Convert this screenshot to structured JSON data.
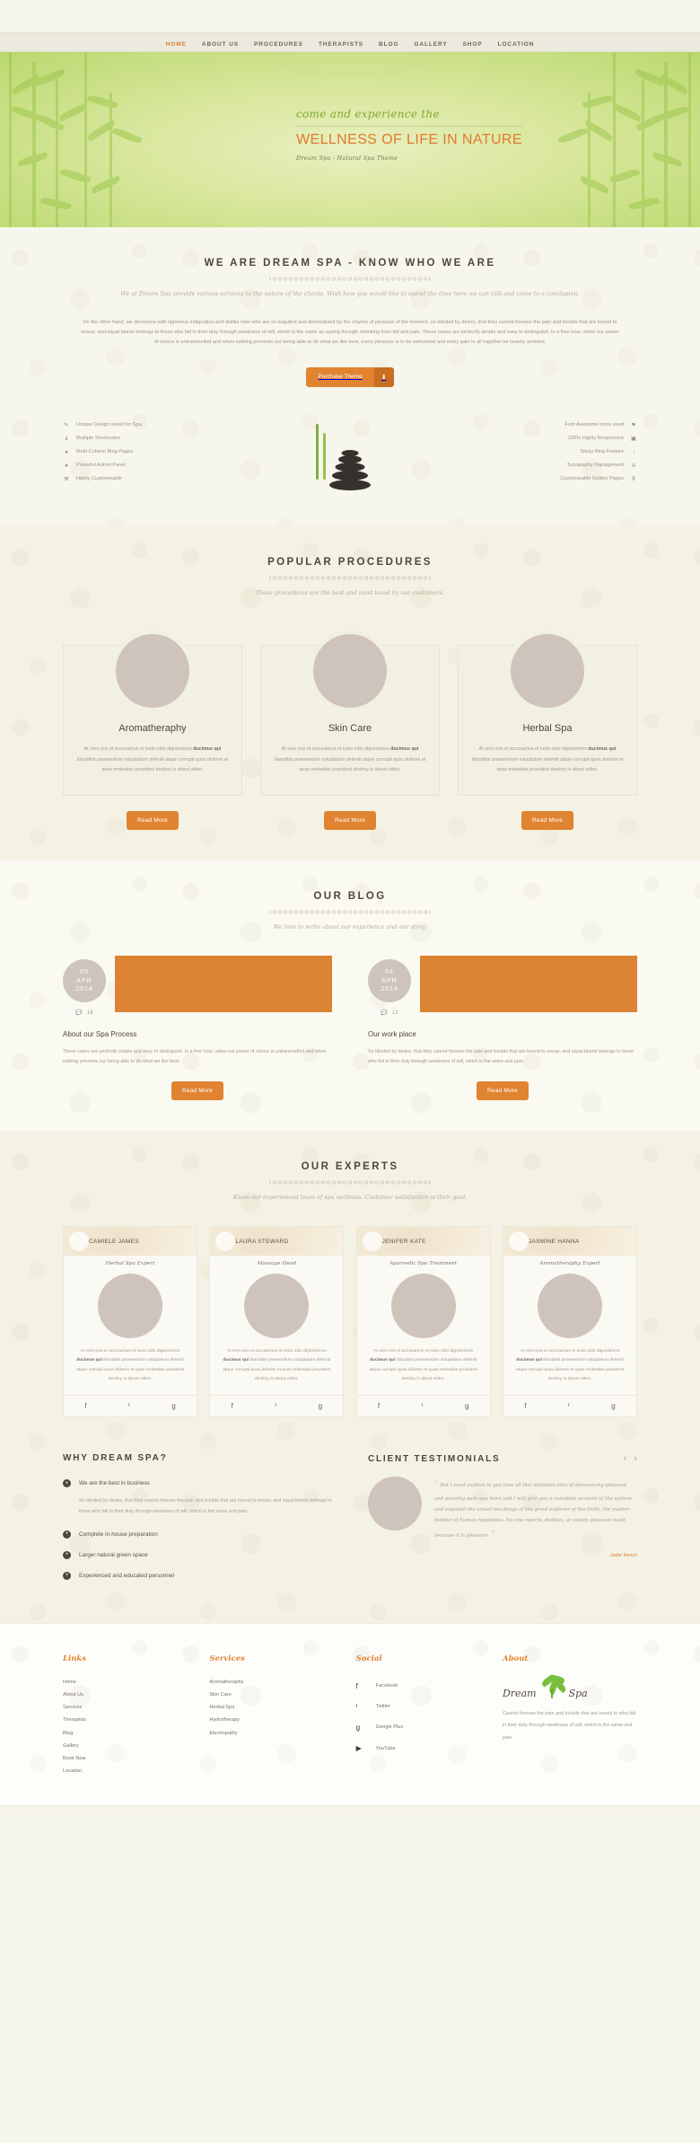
{
  "nav": {
    "items": [
      {
        "label": "HOME",
        "active": true
      },
      {
        "label": "ABOUT US",
        "active": false
      },
      {
        "label": "PROCEDURES",
        "active": false
      },
      {
        "label": "THERAPISTS",
        "active": false
      },
      {
        "label": "BLOG",
        "active": false
      },
      {
        "label": "GALLERY",
        "active": false
      },
      {
        "label": "SHOP",
        "active": false
      },
      {
        "label": "LOCATION",
        "active": false
      }
    ]
  },
  "hero": {
    "pretitle": "come and experience the",
    "title": "WELLNESS OF LIFE IN NATURE",
    "subtitle": "Dream Spa - Natural Spa Theme",
    "accent_green": "#7fa832",
    "accent_orange": "#e07a2c"
  },
  "about": {
    "heading": "WE ARE DREAM SPA - KNOW WHO WE ARE",
    "tagline": "We at Dream Spa provide various services to the nature of the clients. Wish how you would like to spend the time here we can talk and come to a conclusion.",
    "paragraph": "On the other hand, we denounce with righteous indignation and dislike men who are so beguiled and demoralized by the charms of pleasure of the moment, so blinded by desire, that they cannot foresee the pain and trouble that are bound to ensue; and equal blame belongs to those who fail in their duty through weakness of will, which is the same as saying through shrinking from toil and pain. These cases are perfectly simple and easy to distinguish. In a free hour, when our power of choice is untrammelled and when nothing prevents our being able to do what we like best, every pleasure is to be welcomed and every pain in all together be heavily avoided.",
    "purchase_label": "Purchase Theme",
    "purchase_icon": "download-icon",
    "features_left": [
      {
        "icon": "pencil-icon",
        "glyph": "✎",
        "label": "Unique Design suited for Spa"
      },
      {
        "icon": "info-icon",
        "glyph": "ℹ",
        "label": "Multiple Shortcodes"
      },
      {
        "icon": "comment-icon",
        "glyph": "●",
        "label": "Multi-Column Blog Pages"
      },
      {
        "icon": "dot-icon",
        "glyph": "●",
        "label": "Powerful Admin Panel"
      },
      {
        "icon": "wrench-icon",
        "glyph": "⚒",
        "label": "Highly Customisable"
      }
    ],
    "features_right": [
      {
        "icon": "flag-icon",
        "glyph": "⚑",
        "label": "Font Awesome Icons used"
      },
      {
        "icon": "desktop-icon",
        "glyph": "▣",
        "label": "100% Highly Responsive"
      },
      {
        "icon": "pin-icon",
        "glyph": "↓",
        "label": "Sticky Blog Feature"
      },
      {
        "icon": "font-icon",
        "glyph": "A",
        "label": "Typography Management"
      },
      {
        "icon": "filter-icon",
        "glyph": "∇",
        "label": "Customisable Gallery Pages"
      }
    ]
  },
  "procedures": {
    "heading": "POPULAR PROCEDURES",
    "tagline": "These procedures are the best and most loved by our customers.",
    "read_more": "Read More",
    "cards": [
      {
        "title": "Aromatheraphy",
        "body_pre": "At vero eos et accusamus et iusto odio dignissimos ",
        "body_bold": "ducimus qui",
        "body_post": " blanditiis praesentium voluptatum deleniti atque corrupti quos dolores et quas molestias provident destroy is about video."
      },
      {
        "title": "Skin Care",
        "body_pre": "At vero eos et accusamus et iusto odio dignissimos ",
        "body_bold": "ducimus qui",
        "body_post": " blanditiis praesentium voluptatum deleniti atque corrupti quos dolores et quas molestias provident destroy is about video."
      },
      {
        "title": "Herbal Spa",
        "body_pre": "At vero eos et accusamus et iusto odio dignissimos ",
        "body_bold": "ducimus qui",
        "body_post": " blanditiis praesentium voluptatum deleniti atque corrupti quos dolores et quas molestias provident destroy is about video."
      }
    ]
  },
  "blog": {
    "heading": "OUR BLOG",
    "tagline": "We love to write about our experience and our story.",
    "read_more": "Read More",
    "posts": [
      {
        "day": "05",
        "month": "APR",
        "year": "2014",
        "comments": "18",
        "title": "About our Spa Process",
        "body": "These cases are perfectly simple and easy to distinguish. In a free hour, when our power of choice is untrammelled and when nothing prevents our being able to do what we like best.",
        "thumb_color": "#dd8434"
      },
      {
        "day": "04",
        "month": "APR",
        "year": "2014",
        "comments": "12",
        "title": "Our work place",
        "body": "So blinded by desire, that they cannot foresee the pain and trouble that are bound to ensue; and equal blame belongs to those who fail in their duty through weakness of will, which is the same and pain.",
        "thumb_color": "#dd8434"
      }
    ]
  },
  "experts": {
    "heading": "OUR EXPERTS",
    "tagline": "Know our experienced team of spa wellness. Customer satisfaction is their goal.",
    "members": [
      {
        "name": "CAMIELE JAMES",
        "role": "Herbal Spa Expert",
        "body_pre": "At vero eos et accusamus et iusto odio dignissimos ",
        "body_bold": "ducimus qui",
        "body_post": " blanditiis praesentium voluptatum deleniti atque corrupti quos dolores et quas molestias provident destiny is about video.",
        "socials": [
          "facebook-icon",
          "twitter-icon",
          "google-plus-icon"
        ]
      },
      {
        "name": "LAURA STEWARD",
        "role": "Massage Head",
        "body_pre": "At vero eos et accusamus et iusto odio dignissimos ",
        "body_bold": "ducimus qui",
        "body_post": " blanditiis praesentium voluptatum deleniti atque corrupti quos dolores et quas molestias provident destiny is about video.",
        "socials": [
          "facebook-icon",
          "twitter-icon",
          "google-plus-icon"
        ]
      },
      {
        "name": "JENIFER KATE",
        "role": "Ayurvedic Spa Treatment",
        "body_pre": "At vero eos et accusamus et iusto odio dignissimos ",
        "body_bold": "ducimus qui",
        "body_post": " blanditiis praesentium voluptatum deleniti atque corrupti quos dolores et quas molestias provident destiny is about video.",
        "socials": [
          "facebook-icon",
          "twitter-icon",
          "google-plus-icon"
        ]
      },
      {
        "name": "JASMINE HANNA",
        "role": "Aromatheraphy Expert",
        "body_pre": "At vero eos et accusamus et iusto odio dignissimos ",
        "body_bold": "ducimus qui",
        "body_post": " blanditiis praesentium voluptatum deleniti atque corrupti quos dolores et quas molestias provident destiny is about video.",
        "socials": [
          "facebook-icon",
          "twitter-icon",
          "google-plus-icon"
        ]
      }
    ]
  },
  "why": {
    "heading": "WHY DREAM SPA?",
    "items": [
      {
        "title": "We are the best in business",
        "body": "So blinded by desire, that they cannot foresee the pain and trouble that are bound to ensue; and equal blame belongs to those who fail in their duty through weakness of will, which is the same and pain.",
        "open": true
      },
      {
        "title": "Complete in-house preparation",
        "body": "",
        "open": false
      },
      {
        "title": "Larger natural green space",
        "body": "",
        "open": false
      },
      {
        "title": "Experienced and educated personnel",
        "body": "",
        "open": false
      }
    ]
  },
  "testimonials": {
    "heading": "CLIENT TESTIMONIALS",
    "prev_icon": "chevron-left-icon",
    "next_icon": "chevron-right-icon",
    "quote": "But I must explain to you how all this mistaken idea of denouncing pleasure and praising pain was born and I will give you a complete account of the system, and expound the actual teachings of the great explorer of the truth, the master-builder of human happiness. No one rejects, dislikes, or avoids pleasure itself, because it is pleasure.",
    "author": "Jodie french"
  },
  "footer": {
    "columns": [
      {
        "title": "Links",
        "links": [
          "Home",
          "About Us",
          "Services",
          "Therapists",
          "Blog",
          "Gallery",
          "Book Now",
          "Location"
        ]
      },
      {
        "title": "Services",
        "links": [
          "Aromatheraphy",
          "Skin Care",
          "Herbal Spa",
          "Hydrotherapy",
          "Electropathy"
        ]
      }
    ],
    "social": {
      "title": "Social",
      "links": [
        {
          "icon": "facebook-icon",
          "glyph": "f",
          "label": "Facebook"
        },
        {
          "icon": "twitter-icon",
          "glyph": "ᵗ",
          "label": "Twitter"
        },
        {
          "icon": "google-plus-icon",
          "glyph": "g",
          "label": "Google Plus"
        },
        {
          "icon": "youtube-icon",
          "glyph": "▶",
          "label": "YouTube"
        }
      ]
    },
    "about": {
      "title": "About",
      "brand_first": "Dream",
      "brand_second": "Spa",
      "text": "Cannot foresee the pain and trouble that are bound to who fail in their duty through weakness of will, which is the same and pain."
    }
  }
}
